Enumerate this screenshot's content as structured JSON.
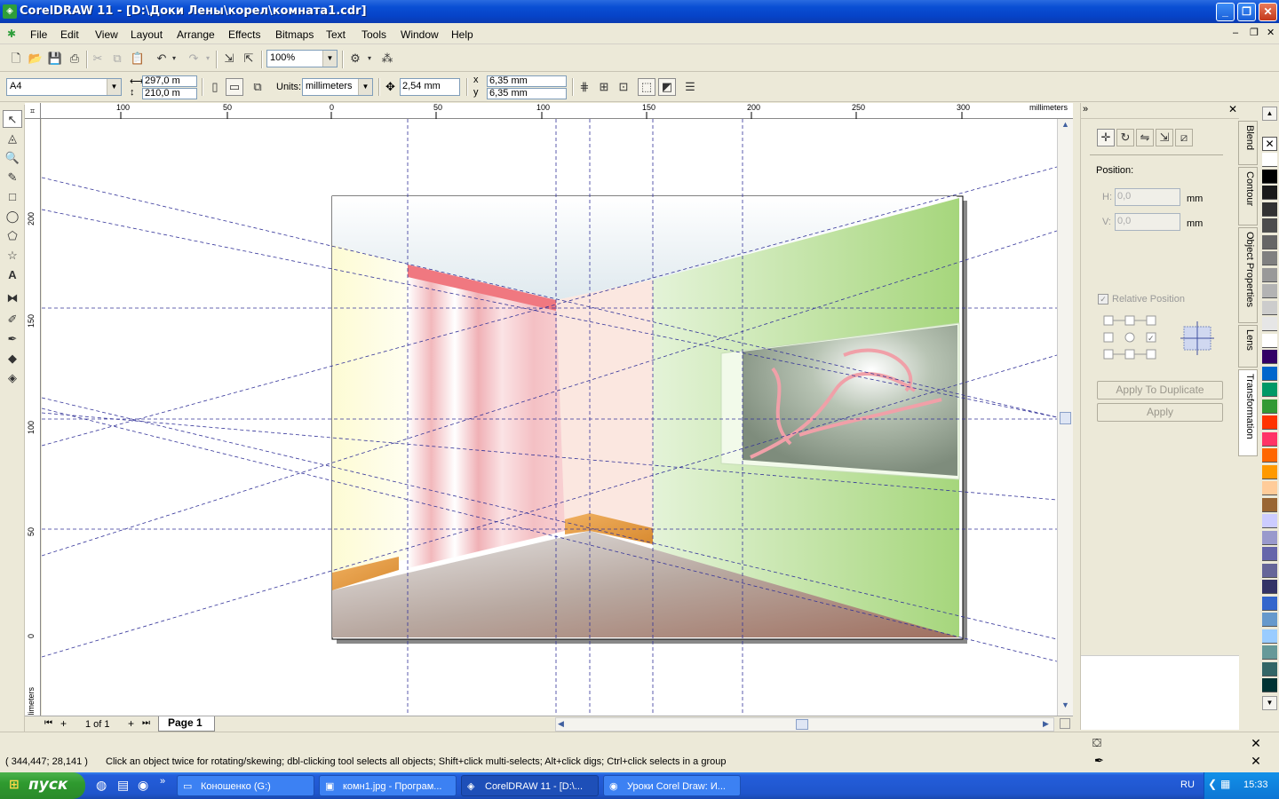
{
  "window": {
    "title": "CorelDRAW 11 - [D:\\Доки Лены\\корел\\комната1.cdr]"
  },
  "menu": [
    "File",
    "Edit",
    "View",
    "Layout",
    "Arrange",
    "Effects",
    "Bitmaps",
    "Text",
    "Tools",
    "Window",
    "Help"
  ],
  "toolbar": {
    "zoom": "100%"
  },
  "propertybar": {
    "paper": "A4",
    "width": "297,0 m",
    "height": "210,0 m",
    "units_label": "Units:",
    "units": "millimeters",
    "nudge": "2,54 mm",
    "dup_x": "6,35 mm",
    "dup_y": "6,35 mm"
  },
  "ruler": {
    "h_ticks": [
      "100",
      "50",
      "0",
      "50",
      "100",
      "150",
      "200",
      "250",
      "300"
    ],
    "h_unit": "millimeters",
    "v_ticks": [
      "200",
      "150",
      "100",
      "50",
      "0"
    ],
    "v_unit": "millimeters"
  },
  "pages": {
    "count": "1 of 1",
    "tab": "Page 1"
  },
  "docker": {
    "position_label": "Position:",
    "h_label": "H:",
    "h_value": "0,0",
    "v_label": "V:",
    "v_value": "0,0",
    "unit": "mm",
    "relative_label": "Relative Position",
    "relative_checked": true,
    "apply_dup": "Apply To Duplicate",
    "apply": "Apply",
    "tabs": [
      "Blend",
      "Contour",
      "Object Properties",
      "Lens",
      "Transformation"
    ]
  },
  "palette": [
    "#ffffff",
    "#000000",
    "#1a1a1a",
    "#333333",
    "#4d4d4d",
    "#666666",
    "#808080",
    "#999999",
    "#b3b3b3",
    "#cccccc",
    "#e6e6e6",
    "#ffffff",
    "#330066",
    "#0066cc",
    "#009966",
    "#339933",
    "#ff3300",
    "#ff3366",
    "#ff6600",
    "#ff9900",
    "#ffcc99",
    "#996633",
    "#ccccff",
    "#9999cc",
    "#6666aa",
    "#666699",
    "#333366",
    "#3366cc",
    "#6699cc",
    "#99ccff",
    "#669999",
    "#336666",
    "#003333"
  ],
  "status": {
    "coords": "( 344,447; 28,141 )",
    "hint": "Click an object twice for rotating/skewing; dbl-clicking tool selects all objects; Shift+click multi-selects; Alt+click digs; Ctrl+click selects in a group"
  },
  "taskbar": {
    "start": "пуск",
    "tasks": [
      "Коношенко (G:)",
      "комн1.jpg - Програм...",
      "CorelDRAW 11 - [D:\\...",
      "Уроки Corel Draw: И..."
    ],
    "lang": "RU",
    "clock": "15:33"
  }
}
